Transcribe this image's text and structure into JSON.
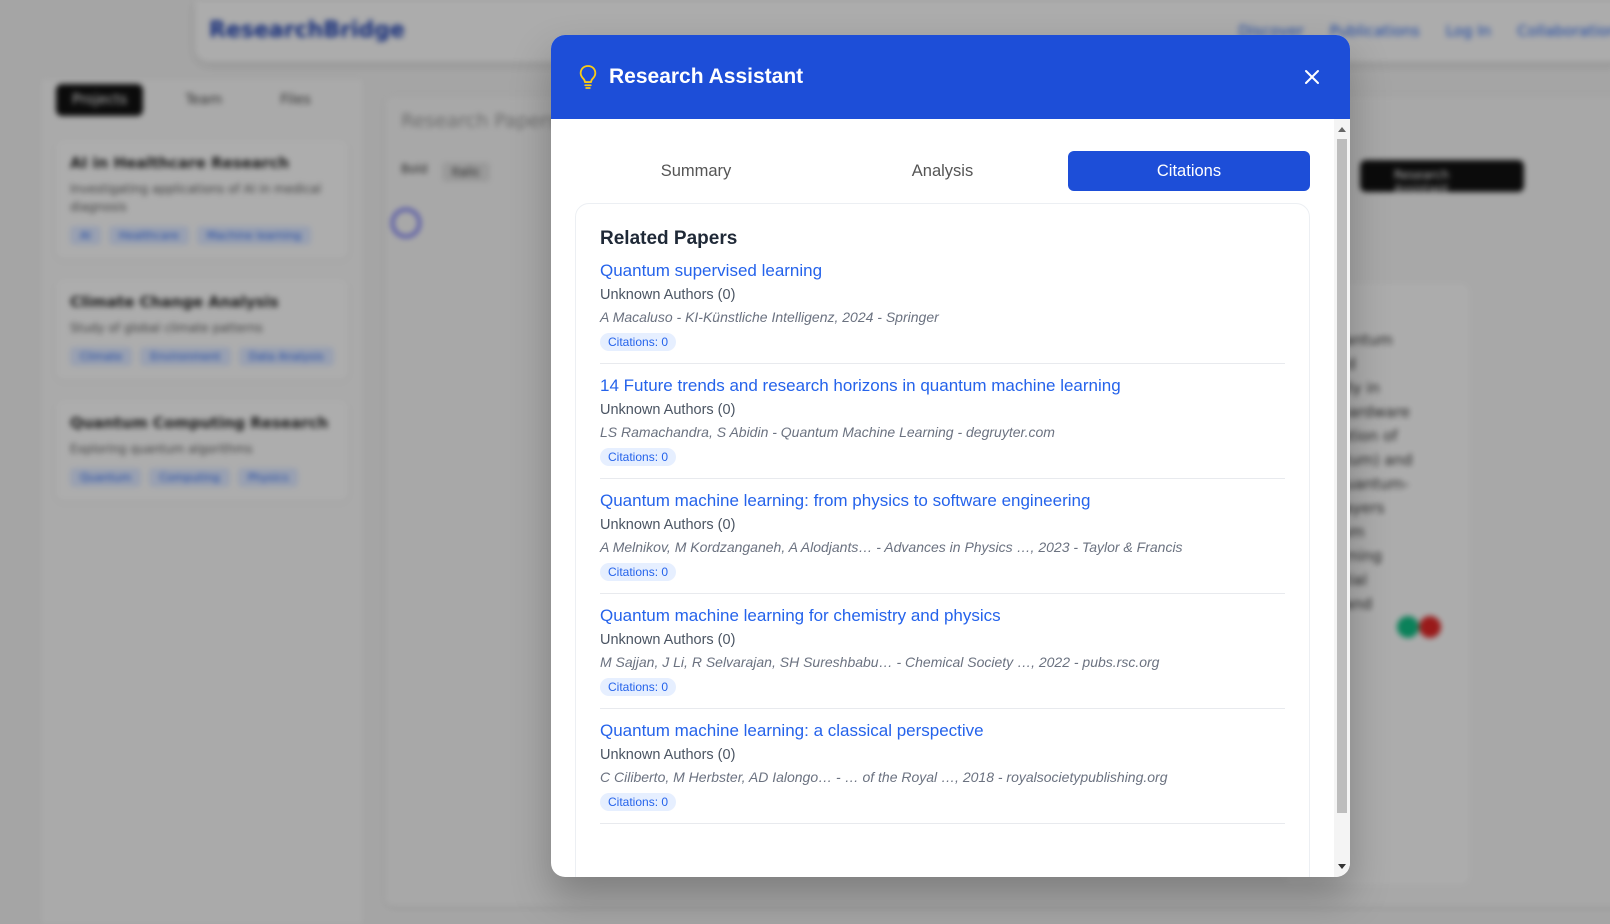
{
  "background": {
    "logo": "ResearchBridge",
    "nav_links": [
      "Discover",
      "Publications",
      "Log In",
      "Collaborations"
    ],
    "sidebar_tabs": [
      "Projects",
      "Team",
      "Files"
    ],
    "projects": [
      {
        "title": "AI in Healthcare Research",
        "description": "Investigating applications of AI in medical diagnosis",
        "tags": [
          "AI",
          "Healthcare",
          "Machine learning"
        ]
      },
      {
        "title": "Climate Change Analysis",
        "description": "Study of global climate patterns",
        "tags": [
          "Climate",
          "Environment",
          "Data Analysis"
        ]
      },
      {
        "title": "Quantum Computing Research",
        "description": "Exploring quantum algorithms",
        "tags": [
          "Quantum",
          "Computing",
          "Physics"
        ]
      }
    ],
    "main_title": "Research Papers",
    "toolbar": {
      "bold": "Bold",
      "italic": "Italic"
    },
    "assistant_button": "Research Assistant",
    "card_lines": [
      "quantum",
      "ised",
      "tially in",
      "n hardware",
      "ntation of",
      "entum) and",
      "r quantum-",
      "e layers",
      "ntum",
      "earning",
      "ential",
      "ct and"
    ]
  },
  "modal": {
    "title": "Research Assistant",
    "header_icon": "lightbulb-icon",
    "close_icon": "close-icon",
    "tabs": [
      {
        "label": "Summary",
        "active": false
      },
      {
        "label": "Analysis",
        "active": false
      },
      {
        "label": "Citations",
        "active": true
      }
    ],
    "section_title": "Related Papers",
    "papers": [
      {
        "title": "Quantum supervised learning",
        "authors": "Unknown Authors (0)",
        "meta": "A Macaluso - KI-Künstliche Intelligenz, 2024 - Springer",
        "citations": "Citations: 0"
      },
      {
        "title": "14 Future trends and research horizons in quantum machine learning",
        "authors": "Unknown Authors (0)",
        "meta": "LS Ramachandra, S Abidin - Quantum Machine Learning - degruyter.com",
        "citations": "Citations: 0"
      },
      {
        "title": "Quantum machine learning: from physics to software engineering",
        "authors": "Unknown Authors (0)",
        "meta": "A Melnikov, M Kordzanganeh, A Alodjants… - Advances in Physics …, 2023 - Taylor & Francis",
        "citations": "Citations: 0"
      },
      {
        "title": "Quantum machine learning for chemistry and physics",
        "authors": "Unknown Authors (0)",
        "meta": "M Sajjan, J Li, R Selvarajan, SH Sureshbabu… - Chemical Society …, 2022 - pubs.rsc.org",
        "citations": "Citations: 0"
      },
      {
        "title": "Quantum machine learning: a classical perspective",
        "authors": "Unknown Authors (0)",
        "meta": "C Ciliberto, M Herbster, AD Ialongo… - … of the Royal …, 2018 - royalsocietypublishing.org",
        "citations": "Citations: 0"
      }
    ]
  },
  "colors": {
    "primary": "#1d4ed8",
    "link": "#2563eb",
    "badge_bg": "#e6efff",
    "bulb": "#facc15"
  }
}
